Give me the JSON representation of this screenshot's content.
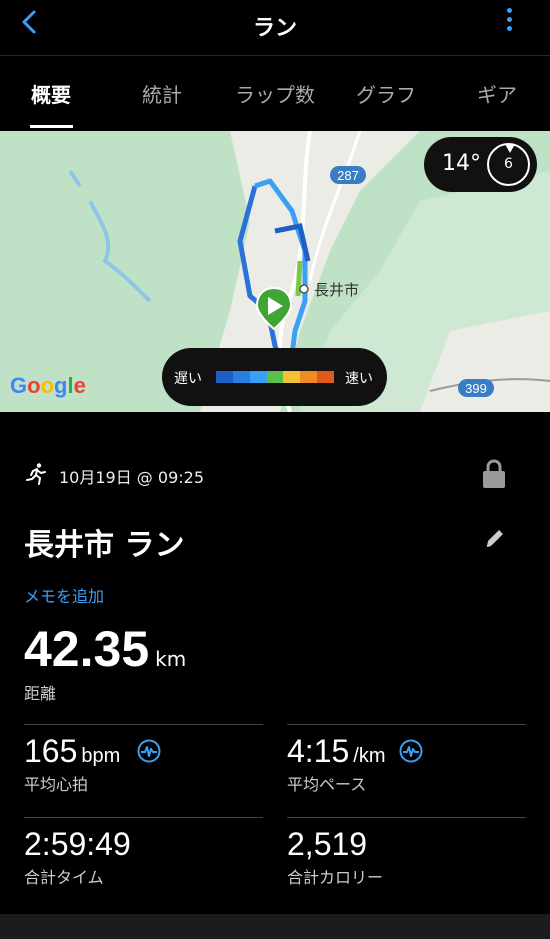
{
  "header": {
    "title": "ラン",
    "back_icon": "chevron-left-icon",
    "menu_icon": "more-vertical-icon",
    "accent": "#3a9ff5"
  },
  "tabs": [
    {
      "label": "概要",
      "active": true
    },
    {
      "label": "統計",
      "active": false
    },
    {
      "label": "ラップ数",
      "active": false
    },
    {
      "label": "グラフ",
      "active": false
    },
    {
      "label": "ギア",
      "active": false
    }
  ],
  "map": {
    "place_label": "長井市",
    "road_badges": [
      "287",
      "399"
    ],
    "attribution": "Google",
    "weather": {
      "temperature": "14°",
      "wind": "6"
    },
    "speed_legend": {
      "slow": "遅い",
      "fast": "速い",
      "colors": [
        "#1e5fc4",
        "#2a7ee0",
        "#3a9ff5",
        "#5cbf4a",
        "#f2c232",
        "#f08a24",
        "#e05a1e"
      ]
    }
  },
  "activity": {
    "datetime": "10月19日 @ 09:25",
    "name": "長井市 ラン",
    "add_note": "メモを追加",
    "distance": {
      "value": "42.35",
      "unit": "km",
      "label": "距離"
    },
    "stats": {
      "heart_rate": {
        "value": "165",
        "unit": "bpm",
        "label": "平均心拍"
      },
      "pace": {
        "value": "4:15",
        "unit": "/km",
        "label": "平均ペース"
      },
      "time": {
        "value": "2:59:49",
        "label": "合計タイム"
      },
      "calories": {
        "value": "2,519",
        "label": "合計カロリー"
      }
    }
  }
}
